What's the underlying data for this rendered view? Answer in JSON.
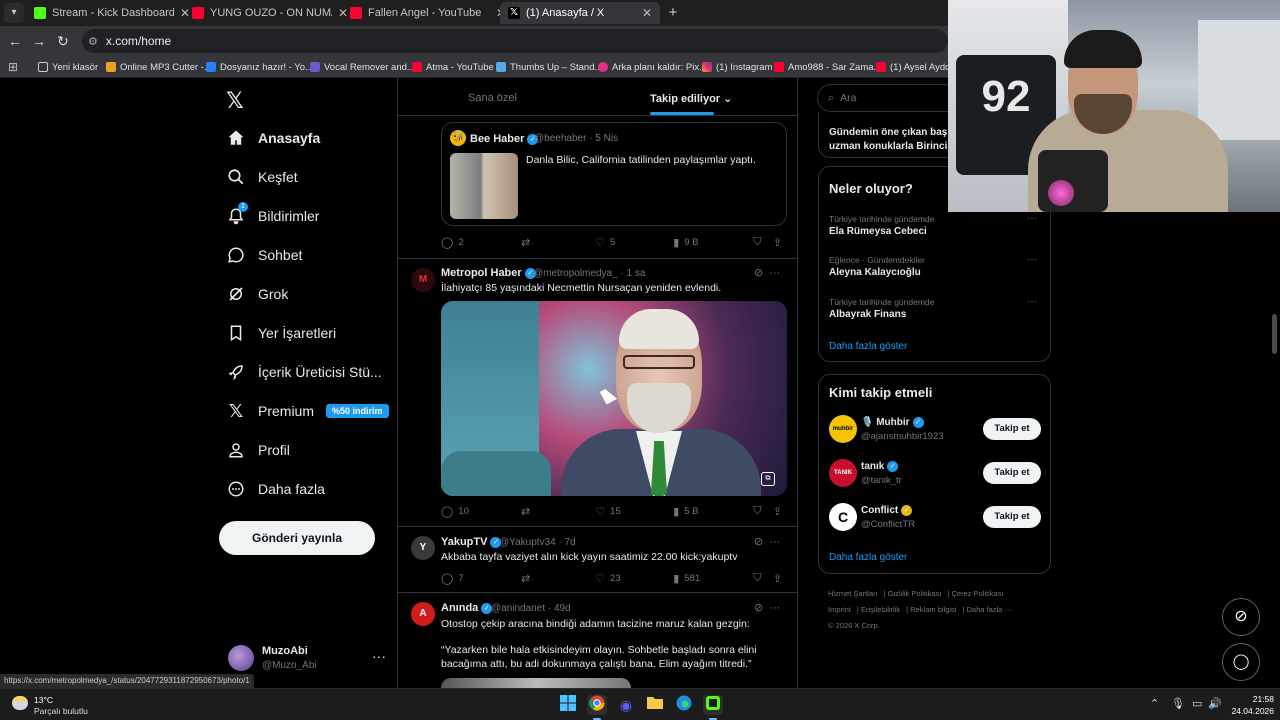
{
  "browser": {
    "tabs": [
      {
        "title": "Stream - Kick Dashboard",
        "favicon_color": "#53fc18"
      },
      {
        "title": "YUNG OUZO - ON NUMARA - Y",
        "favicon_color": "#ff0033"
      },
      {
        "title": "Fallen Angel - YouTube",
        "favicon_color": "#ff0033"
      },
      {
        "title": "(1) Anasayfa / X",
        "favicon_color": "#ffffff"
      }
    ],
    "url": "x.com/home",
    "bookmarks": [
      {
        "label": "Yeni klasör",
        "icon": "folder-icon"
      },
      {
        "label": "Online MP3 Cutter -...",
        "icon": "mp3-cutter-icon"
      },
      {
        "label": "Dosyanız hazır! - Yo...",
        "icon": "file-icon"
      },
      {
        "label": "Vocal Remover and...",
        "icon": "vocal-remover-icon"
      },
      {
        "label": "Atma - YouTube",
        "icon": "youtube-icon"
      },
      {
        "label": "Thumbs Up – Stand...",
        "icon": "thumbs-up-icon"
      },
      {
        "label": "Arka planı kaldır: Pix...",
        "icon": "pixlr-icon"
      },
      {
        "label": "(1) Instagram",
        "icon": "instagram-icon"
      },
      {
        "label": "Amo988 - Sar Zama...",
        "icon": "youtube-icon"
      },
      {
        "label": "(1) Aysel Aydoğ",
        "icon": "youtube-icon"
      }
    ],
    "status_url": "https://x.com/metropolmedya_/status/2047729311872950673/photo/1"
  },
  "nav": {
    "items": [
      {
        "label": "Anasayfa",
        "icon": "home-icon"
      },
      {
        "label": "Keşfet",
        "icon": "search-icon"
      },
      {
        "label": "Bildirimler",
        "icon": "bell-icon",
        "badge": "1"
      },
      {
        "label": "Sohbet",
        "icon": "chat-icon"
      },
      {
        "label": "Grok",
        "icon": "grok-icon"
      },
      {
        "label": "Yer İşaretleri",
        "icon": "bookmark-icon"
      },
      {
        "label": "İçerik Üreticisi Stü...",
        "icon": "rocket-icon"
      },
      {
        "label": "Premium",
        "icon": "x-premium-icon",
        "badge": "%50 indirim"
      },
      {
        "label": "Profil",
        "icon": "person-icon"
      },
      {
        "label": "Daha fazla",
        "icon": "more-circle-icon"
      }
    ],
    "post_button": "Gönderi yayınla",
    "account": {
      "name": "MuzoAbi",
      "handle": "@Muzo_Abi"
    }
  },
  "feed": {
    "tabs": {
      "for_you": "Sana özel",
      "following": "Takip ediliyor"
    },
    "quoted": {
      "name": "Bee Haber",
      "handle_time": "@beehaber · 5 Nis",
      "text": "Danla Bilic, California tatilinden paylaşımlar yaptı."
    },
    "quoted_stats": {
      "replies": "2",
      "likes": "5",
      "views": "9 B"
    },
    "tweets": [
      {
        "name": "Metropol Haber",
        "handle_time": "@metropolmedya_ · 1 sa",
        "text": "İlahiyatçı 85 yaşındaki Necmettin Nursaçan yeniden evlendi.",
        "replies": "10",
        "likes": "15",
        "views": "5 B"
      },
      {
        "name": "YakupTV",
        "handle_time": "@Yakuptv34 · 7d",
        "text": "Akbaba tayfa vaziyet alın kick yayın saatimiz 22.00 kick:yakuptv",
        "replies": "7",
        "likes": "23",
        "views": "581"
      },
      {
        "name": "Anında",
        "handle_time": "@anindanet · 49d",
        "text": "Otostop çekip aracına bindiği adamın tacizine maruz kalan gezgin:",
        "quote": "“Yazarken bile hala etkisindeyim olayın. Sohbetle başladı sonra elini bacağıma attı, bu adi dokunmaya çalıştı bana. Elim ayağım titredi.”"
      }
    ]
  },
  "sidebar": {
    "search_placeholder": "Ara",
    "trend_snippet": "Gündemin öne çıkan başlı\nuzman konuklarla Birinci",
    "whats_happening": {
      "title": "Neler oluyor?",
      "items": [
        {
          "context": "Türkiye tarihinde gündemde",
          "name": "Ela Rümeysa Cebeci"
        },
        {
          "context": "Eğlence · Gündemdekiler",
          "name": "Aleyna Kalaycıoğlu"
        },
        {
          "context": "Türkiye tarihinde gündemde",
          "name": "Albayrak Finans"
        }
      ],
      "show_more": "Daha fazla göster"
    },
    "who_to_follow": {
      "title": "Kimi takip etmeli",
      "items": [
        {
          "name": "🎙️ Muhbir",
          "handle": "@ajansmuhbir1923",
          "avatar_text": "muhbir",
          "avatar_color": "#f5c400"
        },
        {
          "name": "tanık",
          "handle": "@tanik_tr",
          "avatar_text": "TANIK",
          "avatar_color": "#c8102e"
        },
        {
          "name": "Conflict",
          "handle": "@ConflictTR",
          "avatar_text": "C",
          "avatar_color": "#ffffff"
        }
      ],
      "follow_label": "Takip et",
      "show_more": "Daha fazla göster"
    },
    "footer": [
      "Hizmet Şartları",
      "Gizlilik Politikası",
      "Çerez Politikası",
      "Imprint",
      "Erişilebilirlik",
      "Reklam bilgisi",
      "Daha fazla ···",
      "© 2026 X Corp."
    ]
  },
  "taskbar": {
    "weather_temp": "13°C",
    "weather_desc": "Parçalı bulutlu",
    "time": "21:58",
    "date": "24.04.2026"
  }
}
